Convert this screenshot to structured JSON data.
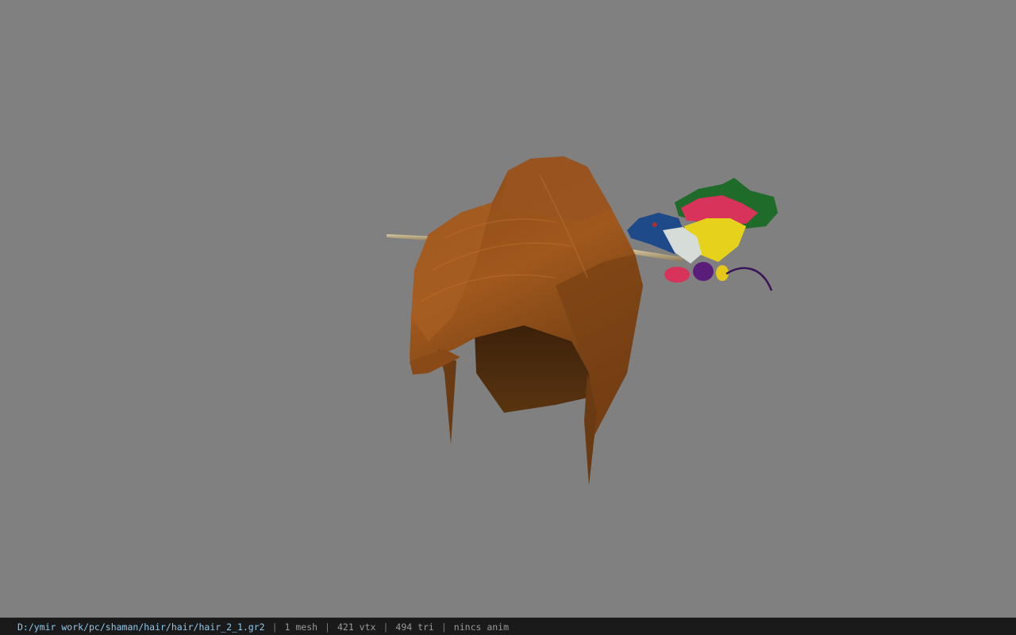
{
  "viewer": {
    "model_icon": "hair-model-with-hairpin",
    "background_color": "#808080"
  },
  "status_bar": {
    "file_path": "D:/ymir work/pc/shaman/hair/hair/hair_2_1.gr2",
    "separator": "|",
    "mesh_count": "1 mesh",
    "vertex_count": "421 vtx",
    "triangle_count": "494 tri",
    "anim_status": "nincs anim",
    "path_color": "#8fc8ec"
  }
}
